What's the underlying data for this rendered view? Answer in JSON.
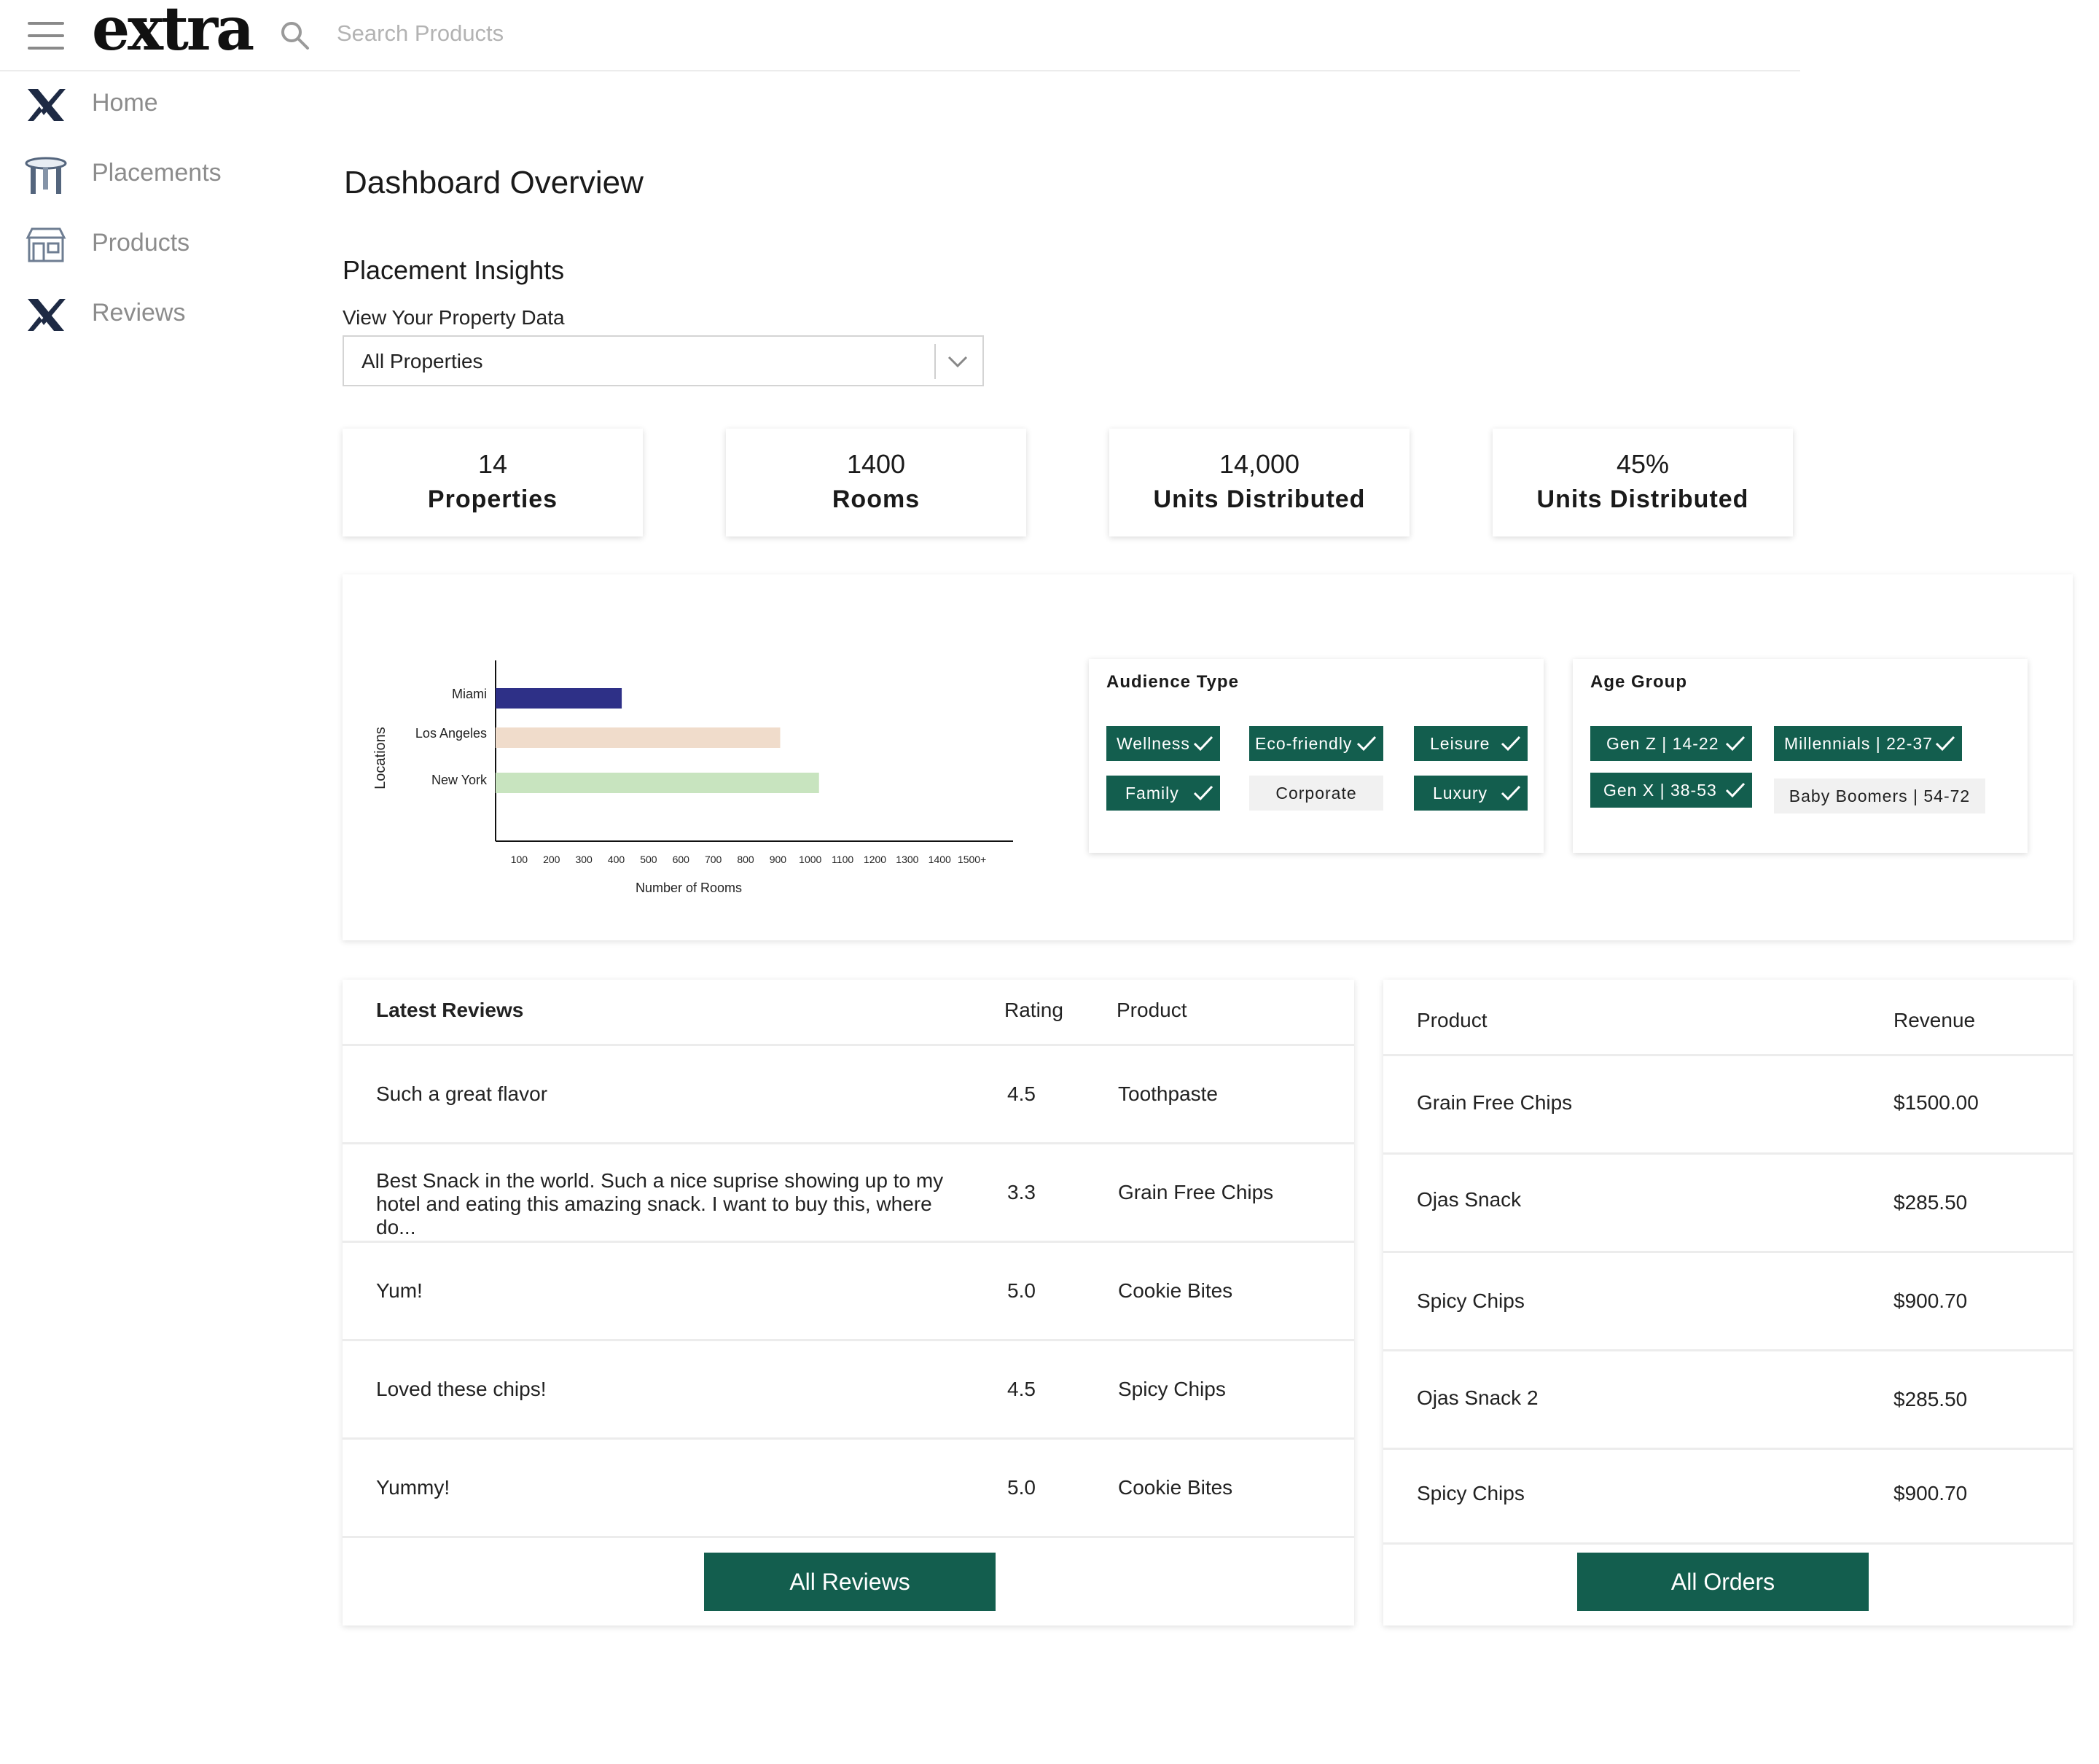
{
  "header": {
    "logo": "extra",
    "search": {
      "placeholder": "Search Products",
      "value": ""
    }
  },
  "sidebar": {
    "items": [
      {
        "label": "Home",
        "icon": "x-logo-icon"
      },
      {
        "label": "Placements",
        "icon": "table-icon"
      },
      {
        "label": "Products",
        "icon": "storefront-icon"
      },
      {
        "label": "Reviews",
        "icon": "x-logo-icon"
      }
    ]
  },
  "main": {
    "title": "Dashboard Overview",
    "section_title": "Placement Insights",
    "select_label": "View Your Property Data",
    "select_value": "All Properties",
    "stats": [
      {
        "value": "14",
        "label": "Properties"
      },
      {
        "value": "1400",
        "label": "Rooms"
      },
      {
        "value": "14,000",
        "label": "Units Distributed"
      },
      {
        "value": "45%",
        "label": "Units Distributed"
      }
    ]
  },
  "chart_data": {
    "type": "bar",
    "orientation": "horizontal",
    "categories": [
      "Miami",
      "Los Angeles",
      "New York"
    ],
    "values": [
      390,
      880,
      1000
    ],
    "colors": [
      "#2e3087",
      "#f0dccb",
      "#c8e4bf"
    ],
    "xlabel": "Number of Rooms",
    "ylabel": "Locations",
    "xticks": [
      "100",
      "200",
      "300",
      "400",
      "500",
      "600",
      "700",
      "800",
      "900",
      "1000",
      "1100",
      "1200",
      "1300",
      "1400",
      "1500+"
    ],
    "xlim": [
      0,
      1600
    ]
  },
  "audience": {
    "title": "Audience Type",
    "tags": [
      {
        "label": "Wellness",
        "selected": true
      },
      {
        "label": "Eco-friendly",
        "selected": true
      },
      {
        "label": "Leisure",
        "selected": true
      },
      {
        "label": "Family",
        "selected": true
      },
      {
        "label": "Corporate",
        "selected": false
      },
      {
        "label": "Luxury",
        "selected": true
      }
    ]
  },
  "age_group": {
    "title": "Age Group",
    "tags": [
      {
        "label": "Gen Z | 14-22",
        "selected": true
      },
      {
        "label": "Millennials | 22-37",
        "selected": true
      },
      {
        "label": "Gen X | 38-53",
        "selected": true
      },
      {
        "label": "Baby Boomers | 54-72",
        "selected": false
      }
    ]
  },
  "reviews": {
    "headers": {
      "review": "Latest Reviews",
      "rating": "Rating",
      "product": "Product"
    },
    "rows": [
      {
        "text": "Such a great flavor",
        "rating": "4.5",
        "product": "Toothpaste"
      },
      {
        "text": "Best Snack in the world. Such a nice suprise showing up to my hotel and eating this amazing snack. I want to buy this, where do...",
        "rating": "3.3",
        "product": "Grain Free Chips"
      },
      {
        "text": "Yum!",
        "rating": "5.0",
        "product": "Cookie Bites"
      },
      {
        "text": "Loved these chips!",
        "rating": "4.5",
        "product": "Spicy Chips"
      },
      {
        "text": "Yummy!",
        "rating": "5.0",
        "product": "Cookie Bites"
      }
    ],
    "button": "All Reviews"
  },
  "orders": {
    "headers": {
      "product": "Product",
      "revenue": "Revenue"
    },
    "rows": [
      {
        "product": "Grain Free Chips",
        "revenue": "$1500.00"
      },
      {
        "product": "Ojas Snack",
        "revenue": "$285.50"
      },
      {
        "product": "Spicy Chips",
        "revenue": "$900.70"
      },
      {
        "product": "Ojas Snack 2",
        "revenue": "$285.50"
      },
      {
        "product": "Spicy Chips",
        "revenue": "$900.70"
      }
    ],
    "button": "All Orders"
  },
  "colors": {
    "accent": "#135e4e",
    "sidebar_text": "#8c8c8c",
    "bar_miami": "#2e3087",
    "bar_la": "#f0dccb",
    "bar_ny": "#c8e4bf"
  }
}
